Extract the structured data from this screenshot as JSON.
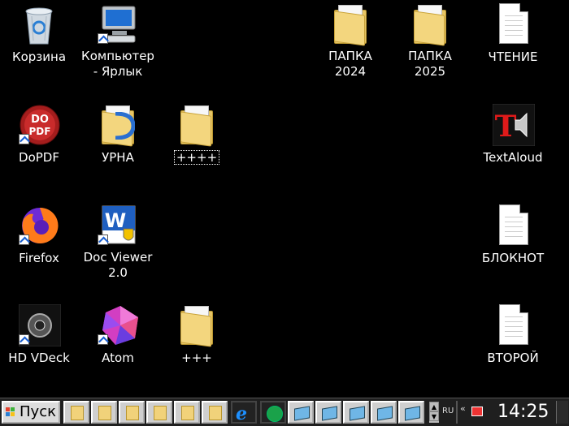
{
  "desktop": {
    "icons": [
      {
        "id": "recycle",
        "label": "Корзина"
      },
      {
        "id": "computer",
        "label": "Компьютер\n- Ярлык"
      },
      {
        "id": "folder2024",
        "label": "ПАПКА\n2024"
      },
      {
        "id": "folder2025",
        "label": "ПАПКА\n2025"
      },
      {
        "id": "chtenie",
        "label": "ЧТЕНИЕ"
      },
      {
        "id": "dopdf",
        "label": "DoPDF",
        "badge": "DO\nPDF"
      },
      {
        "id": "urna",
        "label": "УРНА"
      },
      {
        "id": "plus4",
        "label": "++++"
      },
      {
        "id": "textaloud",
        "label": "TextAloud",
        "badge": "T"
      },
      {
        "id": "firefox",
        "label": "Firefox"
      },
      {
        "id": "docviewer",
        "label": "Doc Viewer\n2.0",
        "badge": "W"
      },
      {
        "id": "bloknot",
        "label": "БЛОКНОТ"
      },
      {
        "id": "hdvdeck",
        "label": "HD VDeck"
      },
      {
        "id": "atom",
        "label": "Atom"
      },
      {
        "id": "plus3",
        "label": "+++"
      },
      {
        "id": "vtoroy",
        "label": "ВТОРОЙ"
      }
    ]
  },
  "taskbar": {
    "start_label": "Пуск",
    "ie_glyph": "e",
    "scroll_up": "▲",
    "scroll_down": "▼",
    "language": "RU",
    "tray_chevron": "«",
    "clock": "14:25"
  },
  "colors": {
    "folder": "#f3d67e",
    "desktop": "#000000",
    "taskbar": "#1f1f1f"
  }
}
